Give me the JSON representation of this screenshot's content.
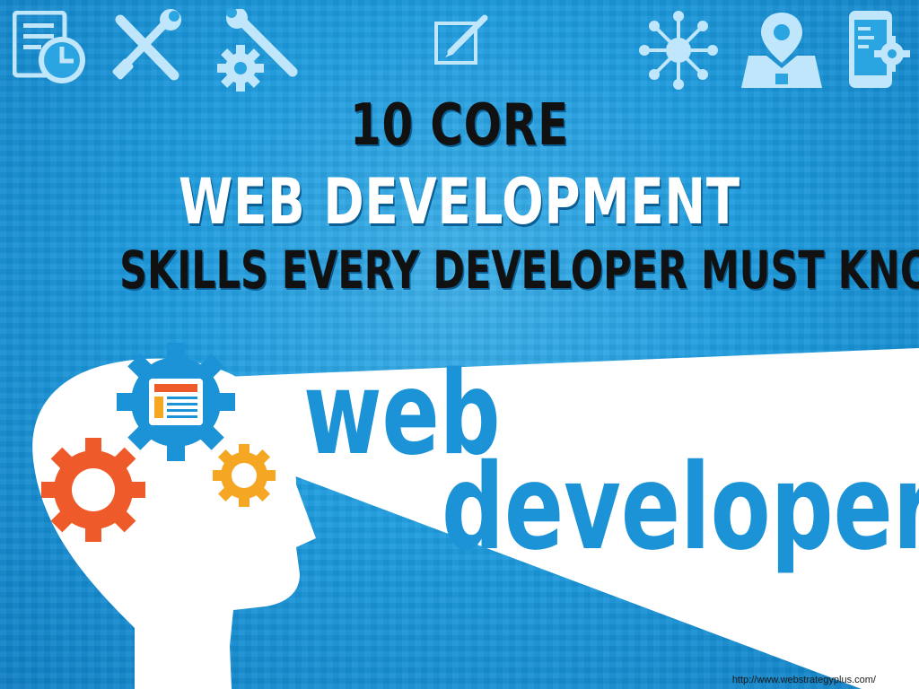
{
  "headline": {
    "line1": "10 CORE",
    "line2": "WEB DEVELOPMENT",
    "line3": "SKILLS EVERY DEVELOPER MUST KNOW"
  },
  "graphic_text": {
    "word1": "web",
    "word2": "developer"
  },
  "footer_url": "http://www.webstrategyplus.com/",
  "top_icons": [
    "document-clock-icon",
    "wrench-screwdriver-icon",
    "wrench-gear-icon",
    "edit-screen-icon",
    "network-hub-icon",
    "map-pin-box-icon",
    "mobile-settings-icon"
  ],
  "colors": {
    "background": "#1d9bde",
    "icon": "#bfe6fb",
    "text_dark": "#111111",
    "text_light": "#ffffff",
    "word_blue": "#1c93d6",
    "gear_red": "#ef5a2a",
    "gear_orange": "#f5a623",
    "gear_blue": "#1c93d6"
  }
}
